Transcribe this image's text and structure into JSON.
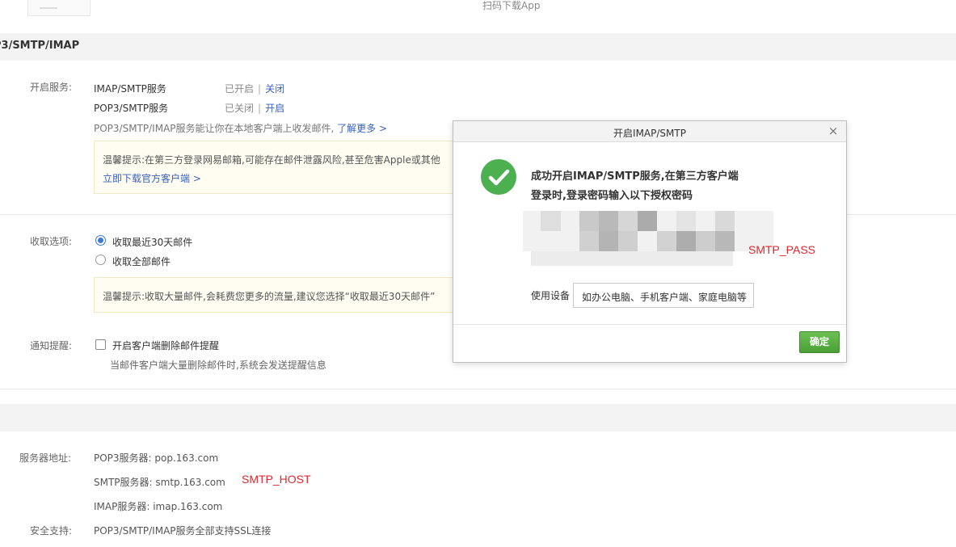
{
  "top": {
    "scan_text": "扫码下载App"
  },
  "section": {
    "title": "P3/SMTP/IMAP"
  },
  "services": {
    "label": "开启服务:",
    "rows": [
      {
        "name": "IMAP/SMTP服务",
        "status": "已开启",
        "action": "关闭"
      },
      {
        "name": "POP3/SMTP服务",
        "status": "已关闭",
        "action": "开启"
      }
    ],
    "desc": "POP3/SMTP/IMAP服务能让你在本地客户端上收发邮件,",
    "learn_more": "了解更多 >"
  },
  "tip1": {
    "text": "温馨提示:在第三方登录网易邮箱,可能存在邮件泄露风险,甚至危害Apple或其他",
    "link": "立即下载官方客户端 >"
  },
  "receive": {
    "label": "收取选项:",
    "options": [
      "收取最近30天邮件",
      "收取全部邮件"
    ],
    "selected": "收取最近30天邮件"
  },
  "tip2": {
    "text": "温馨提示:收取大量邮件,会耗费您更多的流量,建议您选择“收取最近30天邮件”"
  },
  "notify": {
    "label": "通知提醒:",
    "checkbox_label": "开启客户端删除邮件提醒",
    "checked": false,
    "desc": "当邮件客户端大量删除邮件时,系统会发送提醒信息"
  },
  "server": {
    "label": "服务器地址:",
    "pop3": "POP3服务器: pop.163.com",
    "smtp": "SMTP服务器: smtp.163.com",
    "imap": "IMAP服务器: imap.163.com",
    "smtp_annotation": "SMTP_HOST"
  },
  "security": {
    "label": "安全支持:",
    "text": "POP3/SMTP/IMAP服务全部支持SSL连接"
  },
  "dialog": {
    "title": "开启IMAP/SMTP",
    "close_glyph": "×",
    "success_line1": "成功开启IMAP/SMTP服务,在第三方客户端",
    "success_line2": "登录时,登录密码输入以下授权密码",
    "pass_annotation": "SMTP_PASS",
    "device_label": "使用设备",
    "device_placeholder": "如办公电脑、手机客户端、家庭电脑等",
    "ok_label": "确定"
  },
  "colors": {
    "link": "#3a62b8",
    "annotation": "#e0262d",
    "success_green": "#4caf50",
    "ok_button": "#5aae45",
    "radio_selected": "#3b78d8"
  }
}
